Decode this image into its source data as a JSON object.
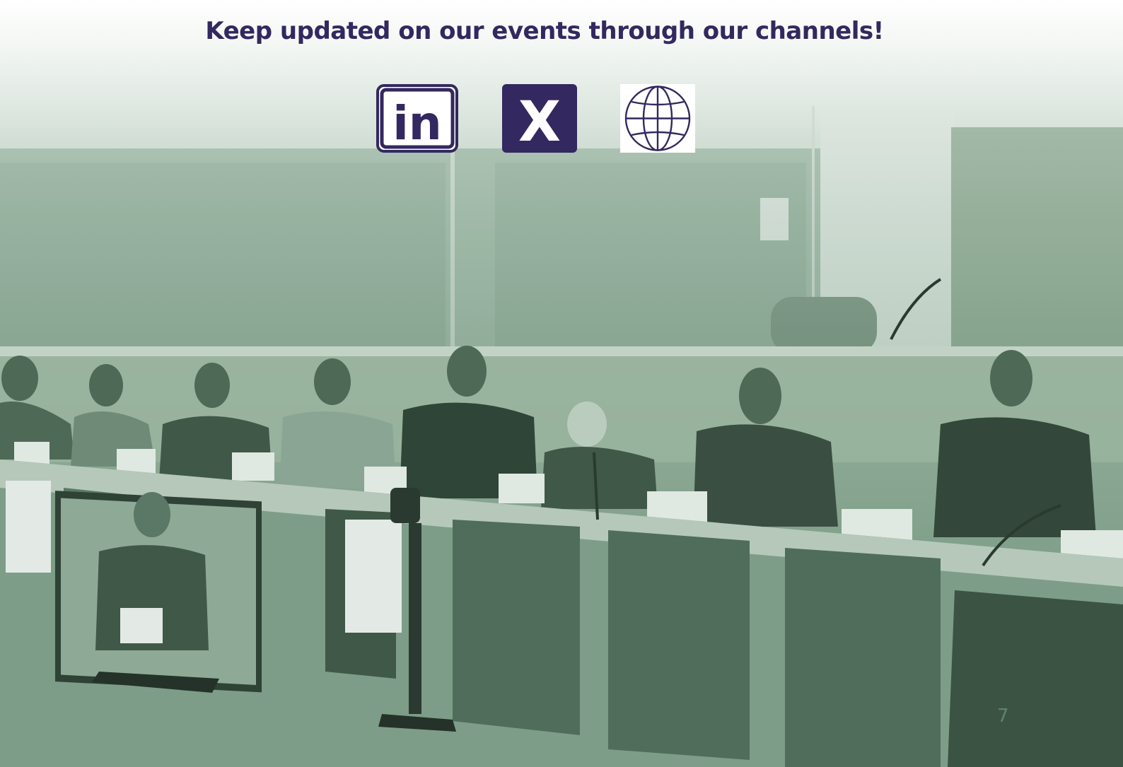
{
  "headline": "Keep updated on our events through our channels!",
  "channels": [
    {
      "name": "linkedin",
      "icon": "linkedin-icon",
      "glyph": "in"
    },
    {
      "name": "x",
      "icon": "x-icon",
      "glyph": "X"
    },
    {
      "name": "website",
      "icon": "globe-icon"
    }
  ],
  "page_number": "7",
  "colors": {
    "brand_purple": "#33285f",
    "overlay_green": "#7d9d88",
    "page_number": "#5f8272"
  },
  "background": {
    "alt": "Panel of speakers seated at a long desk in a conference room with a monitor in the foreground, green-tinted photo"
  }
}
